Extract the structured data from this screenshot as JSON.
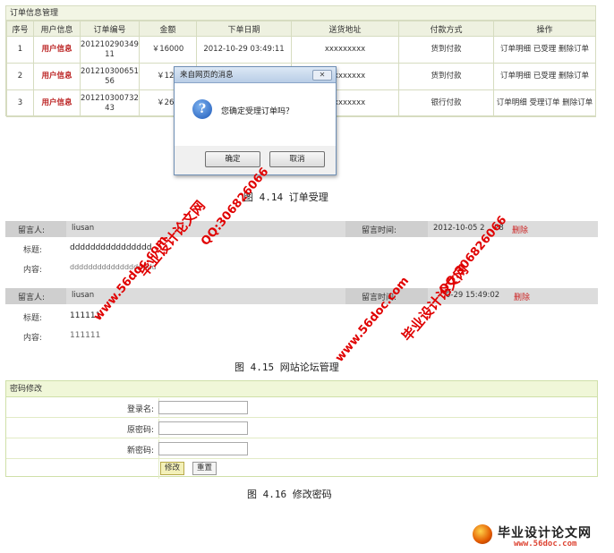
{
  "order_table": {
    "title": "订单信息管理",
    "columns": [
      "序号",
      "用户信息",
      "订单编号",
      "金额",
      "下单日期",
      "送货地址",
      "付款方式",
      "操作"
    ],
    "rows": [
      {
        "no": "1",
        "user": "用户信息",
        "order_id": "20121029034911",
        "amount": "￥16000",
        "date": "2012-10-29 03:49:11",
        "address": "xxxxxxxxx",
        "payment": "货到付款",
        "actions": "订单明细 已受理 删除订单"
      },
      {
        "no": "2",
        "user": "用户信息",
        "order_id": "20121030065156",
        "amount": "￥120",
        "date": "",
        "address": "xxxxxxxxx",
        "payment": "货到付款",
        "actions": "订单明细 已受理 删除订单"
      },
      {
        "no": "3",
        "user": "用户信息",
        "order_id": "20121030073243",
        "amount": "￥260",
        "date": "",
        "address": "xxxxxxxxx",
        "payment": "银行付款",
        "actions": "订单明细 受理订单 删除订单"
      }
    ]
  },
  "dialog": {
    "title": "来自网页的消息",
    "close": "✕",
    "message": "您确定受理订单吗？",
    "ok_label": "确定",
    "cancel_label": "取消"
  },
  "captions": {
    "fig14": "图 4.14 订单受理",
    "fig15": "图 4.15 网站论坛管理",
    "fig16": "图 4.16 修改密码"
  },
  "forum": {
    "posts": [
      {
        "poster_label": "留言人:",
        "poster": "liusan",
        "time_label": "留言时间:",
        "time": "2012-10-05 2",
        "time_tail": "28",
        "delete": "删除",
        "title_label": "标题:",
        "title": "dddddddddddddddd",
        "content_label": "内容:",
        "content": "ddddddddddddddddddd"
      },
      {
        "poster_label": "留言人:",
        "poster": "liusan",
        "time_label": "留言时间:",
        "time": "",
        "time_tail": "0-29 15:49:02",
        "delete": "删除",
        "title_label": "标题:",
        "title": "111111",
        "content_label": "内容:",
        "content": "111111"
      }
    ]
  },
  "password_form": {
    "title": "密码修改",
    "login_label": "登录名:",
    "old_label": "原密码:",
    "new_label": "新密码:",
    "submit_label": "修改",
    "reset_label": "重置"
  },
  "watermarks": {
    "site_cn": "毕业设计论文网",
    "qq": "QQ:306826066",
    "url": "www.56doc.com",
    "logo_cn": "毕业设计论文网",
    "logo_url": "www.56doc.com"
  },
  "colors": {
    "accent_red": "#cc2222",
    "watermark_red": "#e00000",
    "header_bg": "#eef1e0"
  }
}
